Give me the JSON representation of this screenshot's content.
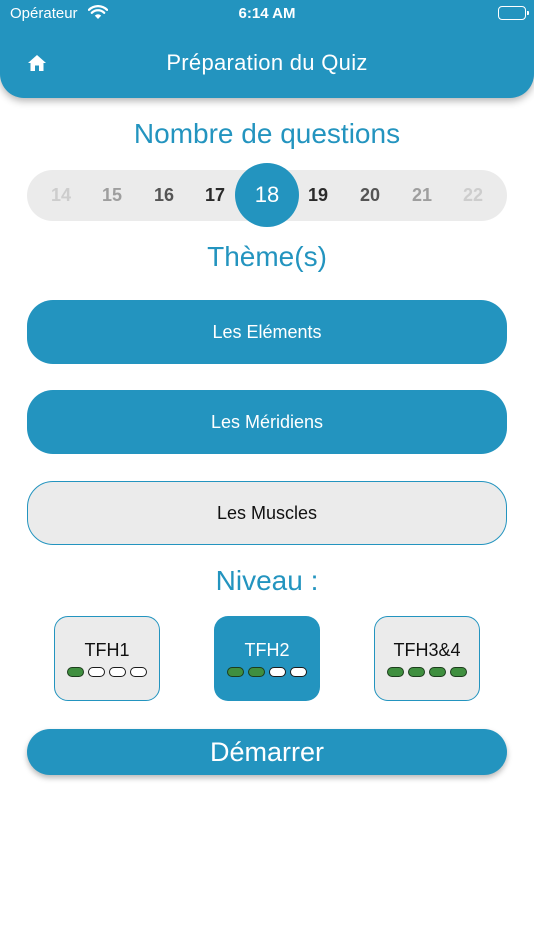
{
  "status_bar": {
    "carrier": "Opérateur",
    "time": "6:14 AM"
  },
  "header": {
    "title": "Préparation du Quiz",
    "home_icon": "home-icon"
  },
  "questions": {
    "title": "Nombre de questions",
    "options": [
      "14",
      "15",
      "16",
      "17",
      "18",
      "19",
      "20",
      "21",
      "22"
    ],
    "selected": "18"
  },
  "themes": {
    "title": "Thème(s)",
    "items": [
      {
        "label": "Les Eléments",
        "selected": true
      },
      {
        "label": "Les Méridiens",
        "selected": true
      },
      {
        "label": "Les Muscles",
        "selected": false
      }
    ]
  },
  "level": {
    "title": "Niveau :",
    "items": [
      {
        "label": "TFH1",
        "dots_filled": 1,
        "dots_total": 4,
        "selected": false
      },
      {
        "label": "TFH2",
        "dots_filled": 2,
        "dots_total": 4,
        "selected": true
      },
      {
        "label": "TFH3&4",
        "dots_filled": 4,
        "dots_total": 4,
        "selected": false
      }
    ]
  },
  "start_button": {
    "label": "Démarrer"
  },
  "colors": {
    "accent": "#2394bf",
    "chip_bg": "#ebebeb",
    "dot_on": "#3f8f3f"
  }
}
